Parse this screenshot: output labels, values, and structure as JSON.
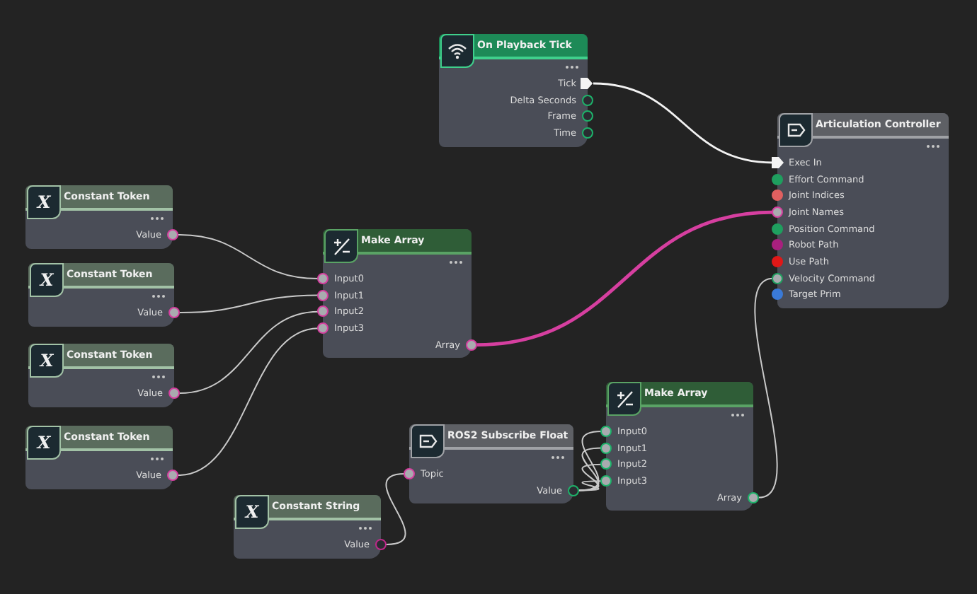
{
  "nodes": [
    {
      "kind": "event",
      "title": "On Playback Tick",
      "outputs": [
        {
          "label": "Tick",
          "kind": "exec"
        },
        {
          "label": "Delta Seconds",
          "kind": "hollow",
          "color": "#1db36a"
        },
        {
          "label": "Frame",
          "kind": "hollow",
          "color": "#1db36a"
        },
        {
          "label": "Time",
          "kind": "hollow",
          "color": "#1db36a"
        }
      ]
    },
    {
      "kind": "action",
      "title": "Articulation Controller",
      "inputs": [
        {
          "label": "Exec In",
          "kind": "exec"
        },
        {
          "label": "Effort Command",
          "kind": "filled",
          "color": "#1f9f5f"
        },
        {
          "label": "Joint Indices",
          "kind": "filled",
          "color": "#e06060"
        },
        {
          "label": "Joint Names",
          "kind": "ring",
          "color": "#d63fa0"
        },
        {
          "label": "Position Command",
          "kind": "filled",
          "color": "#1f9f5f"
        },
        {
          "label": "Robot Path",
          "kind": "filled",
          "color": "#a8207e"
        },
        {
          "label": "Use Path",
          "kind": "filled",
          "color": "#e01818"
        },
        {
          "label": "Velocity Command",
          "kind": "ring",
          "color": "#1f9f5f"
        },
        {
          "label": "Target Prim",
          "kind": "filled",
          "color": "#3a7ad8"
        }
      ]
    },
    {
      "kind": "constant",
      "title": "Constant Token",
      "symbol": "X",
      "outputs": [
        {
          "label": "Value",
          "kind": "ring",
          "color": "#d63fa0"
        }
      ]
    },
    {
      "kind": "constant",
      "title": "Constant Token",
      "symbol": "X",
      "outputs": [
        {
          "label": "Value",
          "kind": "ring",
          "color": "#d63fa0"
        }
      ]
    },
    {
      "kind": "constant",
      "title": "Constant Token",
      "symbol": "X",
      "outputs": [
        {
          "label": "Value",
          "kind": "ring",
          "color": "#d63fa0"
        }
      ]
    },
    {
      "kind": "constant",
      "title": "Constant Token",
      "symbol": "X",
      "outputs": [
        {
          "label": "Value",
          "kind": "ring",
          "color": "#d63fa0"
        }
      ]
    },
    {
      "kind": "function",
      "title": "Make Array",
      "inputs": [
        {
          "label": "Input0",
          "kind": "ring",
          "color": "#d63fa0"
        },
        {
          "label": "Input1",
          "kind": "ring",
          "color": "#d63fa0"
        },
        {
          "label": "Input2",
          "kind": "ring",
          "color": "#d63fa0"
        },
        {
          "label": "Input3",
          "kind": "ring",
          "color": "#d63fa0"
        }
      ],
      "outputs": [
        {
          "label": "Array",
          "kind": "ring",
          "color": "#d63fa0"
        }
      ]
    },
    {
      "kind": "action",
      "title": "ROS2 Subscribe Float",
      "inputs": [
        {
          "label": "Topic",
          "kind": "ring",
          "color": "#d63fa0"
        }
      ],
      "outputs": [
        {
          "label": "Value",
          "kind": "hollow",
          "color": "#1db36a"
        }
      ]
    },
    {
      "kind": "constant",
      "title": "Constant String",
      "symbol": "X",
      "outputs": [
        {
          "label": "Value",
          "kind": "hollow",
          "color": "#c0288a"
        }
      ]
    },
    {
      "kind": "function",
      "title": "Make Array",
      "inputs": [
        {
          "label": "Input0",
          "kind": "ring",
          "color": "#1db36a"
        },
        {
          "label": "Input1",
          "kind": "ring",
          "color": "#1db36a"
        },
        {
          "label": "Input2",
          "kind": "ring",
          "color": "#1db36a"
        },
        {
          "label": "Input3",
          "kind": "ring",
          "color": "#1db36a"
        }
      ],
      "outputs": [
        {
          "label": "Array",
          "kind": "ring",
          "color": "#1db36a"
        }
      ]
    }
  ]
}
